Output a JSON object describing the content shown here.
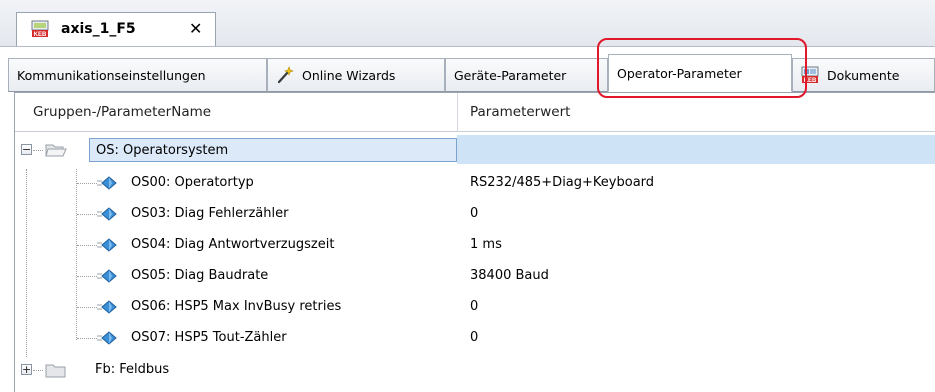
{
  "document_tab": {
    "title": "axis_1_F5",
    "close_glyph": "✕",
    "icon": "keb-file-icon"
  },
  "sub_tabs": [
    {
      "label": "Kommunikationseinstellungen",
      "icon": ""
    },
    {
      "label": "Online Wizards",
      "icon": "wizard-wand-icon"
    },
    {
      "label": "Geräte-Parameter",
      "icon": ""
    },
    {
      "label": "Operator-Parameter",
      "icon": "",
      "active": true
    },
    {
      "label": "Dokumente",
      "icon": "keb-document-icon"
    }
  ],
  "grid": {
    "col_name": "Gruppen-/ParameterName",
    "col_value": "Parameterwert"
  },
  "tree": {
    "group_os": {
      "label": "OS: Operatorsystem",
      "expander": "−",
      "selected": true
    },
    "params": [
      {
        "label": "OS00: Operatortyp",
        "value": "RS232/485+Diag+Keyboard"
      },
      {
        "label": "OS03: Diag Fehlerzähler",
        "value": "0"
      },
      {
        "label": "OS04: Diag Antwortverzugszeit",
        "value": "1 ms"
      },
      {
        "label": "OS05: Diag Baudrate",
        "value": "38400 Baud"
      },
      {
        "label": "OS06: HSP5 Max InvBusy retries",
        "value": "0"
      },
      {
        "label": "OS07: HSP5 Tout-Zähler",
        "value": "0"
      }
    ],
    "group_fb": {
      "label": "Fb: Feldbus",
      "expander": "+"
    }
  },
  "colors": {
    "highlight_ring": "#e0182a",
    "selection_band": "#cfe3f6",
    "selection_border": "#7da2ce"
  }
}
